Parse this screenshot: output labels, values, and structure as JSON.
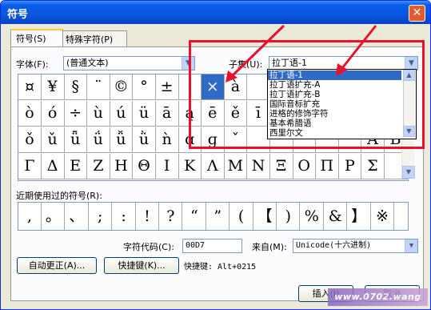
{
  "window": {
    "title": "符号"
  },
  "tabs": [
    {
      "label": "符号(S)"
    },
    {
      "label": "特殊字符(P)"
    }
  ],
  "font": {
    "label": "字体(F):",
    "value": "(普通文本)"
  },
  "subset": {
    "label": "子集(U):",
    "value": "拉丁语-1"
  },
  "subset_options": [
    "拉丁语-1",
    "拉丁语扩充-A",
    "拉丁语扩充-B",
    "国际音标扩充",
    "进格的修饰字符",
    "基本希腊语",
    "西里尔文"
  ],
  "symbols": [
    [
      "¤",
      "¥",
      "§",
      "¨",
      "©",
      "°",
      "±",
      "·",
      "×",
      "à",
      "",
      "",
      "",
      "",
      "",
      "",
      ""
    ],
    [
      "ò",
      "ó",
      "÷",
      "ù",
      "ú",
      "ü",
      "ā",
      "ą",
      "ē",
      "ě",
      "ī",
      "",
      "",
      "",
      "",
      "",
      ""
    ],
    [
      "ǒ",
      "ǔ",
      "ǖ",
      "ǘ",
      "ǚ",
      "ǜ",
      "ǹ",
      "ɑ",
      "ɡ",
      "ˇ",
      "",
      "",
      "",
      "",
      "",
      "Α",
      "Β"
    ],
    [
      "Γ",
      "Δ",
      "Ε",
      "Ζ",
      "Η",
      "Θ",
      "Ι",
      "Κ",
      "Λ",
      "Μ",
      "Ν",
      "Ξ",
      "Ο",
      "Π",
      "Ρ",
      "Σ",
      ""
    ]
  ],
  "recent": {
    "label": "近期使用过的符号(R):",
    "symbols": [
      ",",
      "。",
      "、",
      ";",
      ":",
      "!",
      "?",
      "“",
      "”",
      "(",
      "【",
      ")",
      "%",
      "&",
      "】",
      "※"
    ]
  },
  "char_code": {
    "label": "字符代码(C):",
    "value": "00D7"
  },
  "from": {
    "label": "来自(M):",
    "value": "Unicode(十六进制)"
  },
  "buttons": {
    "autocorrect": "自动更正(A)...",
    "shortcut": "快捷键(K)...",
    "shortcut_text": "快捷键: Alt+0215",
    "insert": "插入(I)",
    "cancel": "取消"
  },
  "watermark": "www.0702.wang"
}
